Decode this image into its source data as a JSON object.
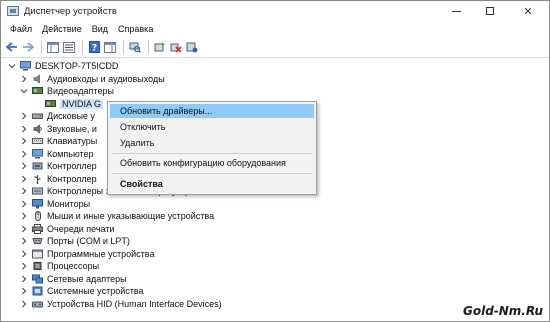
{
  "window": {
    "title": "Диспетчер устройств",
    "controls": {
      "minimize": "–",
      "maximize": "□",
      "close": "✕"
    }
  },
  "menu": [
    "Файл",
    "Действие",
    "Вид",
    "Справка"
  ],
  "tree": {
    "root": "DESKTOP-7T5ICDD",
    "items": [
      {
        "label": "Аудиовходы и аудиовыходы",
        "icon": "audio-io-icon",
        "expanded": false
      },
      {
        "label": "Видеоадаптеры",
        "icon": "display-adapter-icon",
        "expanded": true
      },
      {
        "label": "NVIDIA G",
        "icon": "gpu-device-icon",
        "child": true,
        "selected": true
      },
      {
        "label": "Дисковые у",
        "icon": "disk-drive-icon",
        "expanded": false
      },
      {
        "label": "Звуковые, и",
        "icon": "sound-icon",
        "expanded": false
      },
      {
        "label": "Клавиатуры",
        "icon": "keyboard-icon",
        "expanded": false
      },
      {
        "label": "Компьютер",
        "icon": "computer-icon",
        "expanded": false
      },
      {
        "label": "Контроллер",
        "icon": "controller-icon",
        "expanded": false
      },
      {
        "label": "Контроллер",
        "icon": "controller-icon",
        "expanded": false
      },
      {
        "label": "Контроллеры запоминающих устройств",
        "icon": "storage-controller-icon",
        "expanded": false
      },
      {
        "label": "Мониторы",
        "icon": "monitor-icon",
        "expanded": false
      },
      {
        "label": "Мыши и иные указывающие устройства",
        "icon": "mouse-icon",
        "expanded": false
      },
      {
        "label": "Очереди печати",
        "icon": "print-queue-icon",
        "expanded": false
      },
      {
        "label": "Порты (COM и LPT)",
        "icon": "port-icon",
        "expanded": false
      },
      {
        "label": "Программные устройства",
        "icon": "software-device-icon",
        "expanded": false
      },
      {
        "label": "Процессоры",
        "icon": "processor-icon",
        "expanded": false
      },
      {
        "label": "Сетевые адаптеры",
        "icon": "network-adapter-icon",
        "expanded": false
      },
      {
        "label": "Системные устройства",
        "icon": "system-device-icon",
        "expanded": false
      },
      {
        "label": "Устройства HID (Human Interface Devices)",
        "icon": "hid-icon",
        "expanded": false
      }
    ]
  },
  "context_menu": {
    "items": [
      {
        "label": "Обновить драйверы...",
        "highlighted": true
      },
      {
        "label": "Отключить"
      },
      {
        "label": "Удалить"
      },
      {
        "label": "Обновить конфигурацию оборудования"
      },
      {
        "label": "Свойства",
        "bold": true
      }
    ]
  },
  "watermark": "Gold-Nm.Ru",
  "colors": {
    "selection": "#cde6f7",
    "menu_highlight": "#91c9f7",
    "menu_bg": "#f2f2f2"
  }
}
